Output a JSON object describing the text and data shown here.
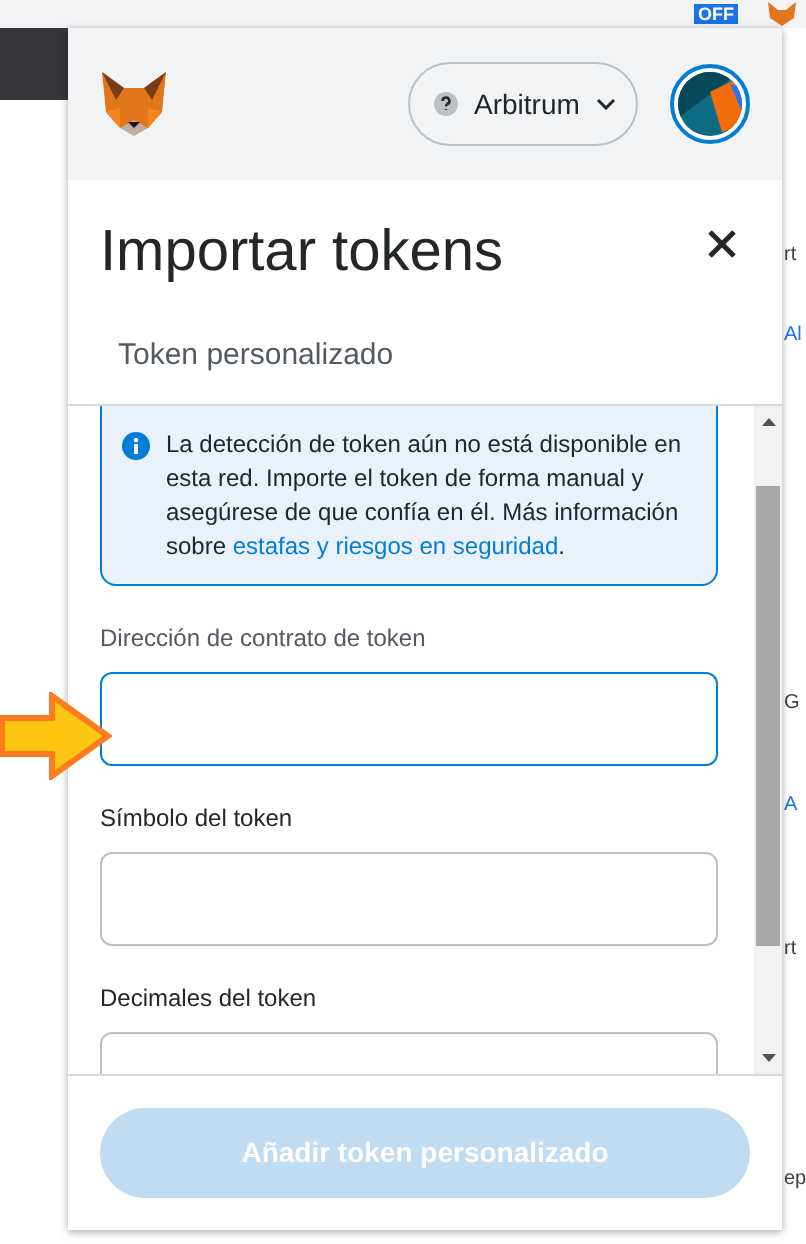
{
  "browser_toolbar": {
    "extension_badge": "OFF"
  },
  "background_page": {
    "fragments": [
      {
        "text": "rt",
        "kind": "text"
      },
      {
        "text": "Al",
        "kind": "link"
      },
      {
        "text": "G",
        "kind": "text"
      },
      {
        "text": "A",
        "kind": "link"
      },
      {
        "text": "rt",
        "kind": "text"
      },
      {
        "text": "ep",
        "kind": "text"
      }
    ]
  },
  "popup": {
    "network": "Arbitrum",
    "title": "Importar tokens",
    "tab": "Token personalizado",
    "notice": {
      "text": "La detección de token aún no está disponible en esta red. Importe el token de forma manual y asegúrese de que confía en él. Más información sobre ",
      "link": "estafas y riesgos en seguridad",
      "after": "."
    },
    "fields": [
      {
        "label": "Dirección de contrato de token",
        "focused": true
      },
      {
        "label": "Símbolo del token",
        "focused": false
      },
      {
        "label": "Decimales del token",
        "focused": false
      }
    ],
    "button": {
      "label": "Añadir token personalizado",
      "disabled": true
    }
  }
}
